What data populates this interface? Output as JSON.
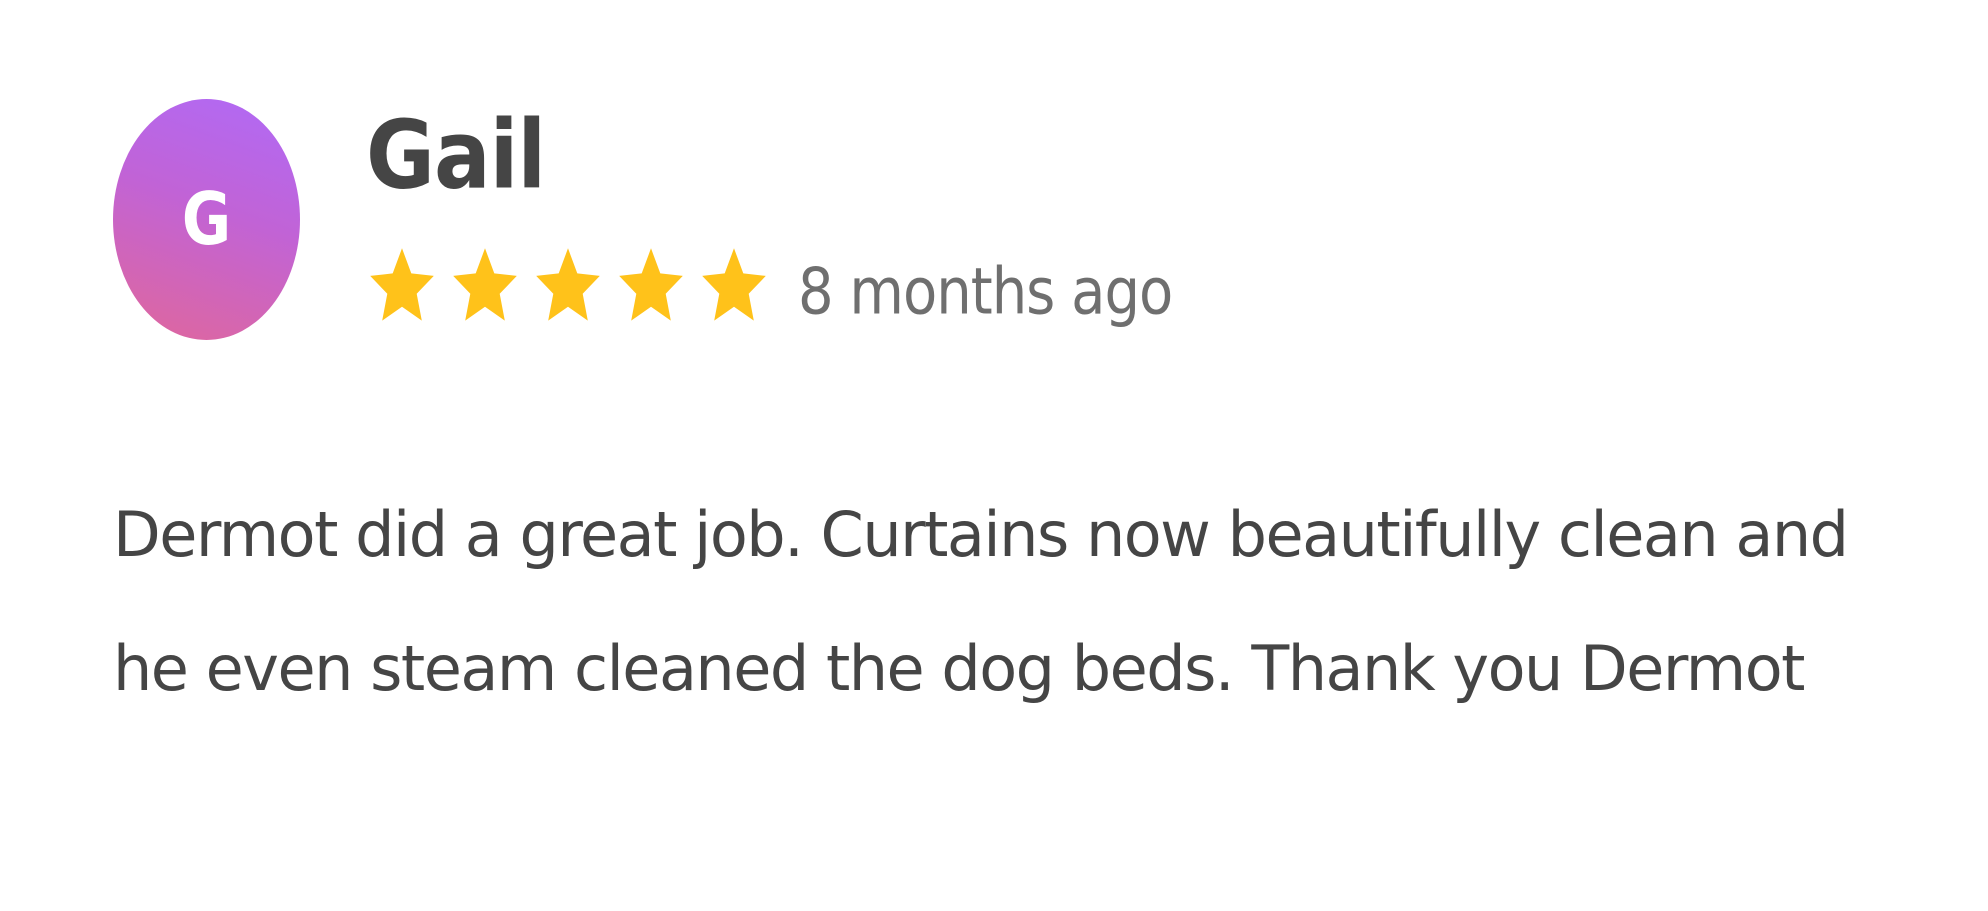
{
  "review": {
    "avatar_initial": "G",
    "reviewer_name": "Gail",
    "rating": 5,
    "rating_max": 5,
    "time_ago": "8 months ago",
    "text": "Dermot did a great job. Curtains now beautifully clean and he even steam cleaned the dog beds. Thank you Dermot"
  },
  "icons": {
    "star": "star-icon"
  },
  "colors": {
    "star": "#ffc21a",
    "avatar_gradient_top": "#b06af7",
    "avatar_gradient_bottom": "#e0679b",
    "text": "#454545",
    "muted_text": "#6f6f6f"
  }
}
